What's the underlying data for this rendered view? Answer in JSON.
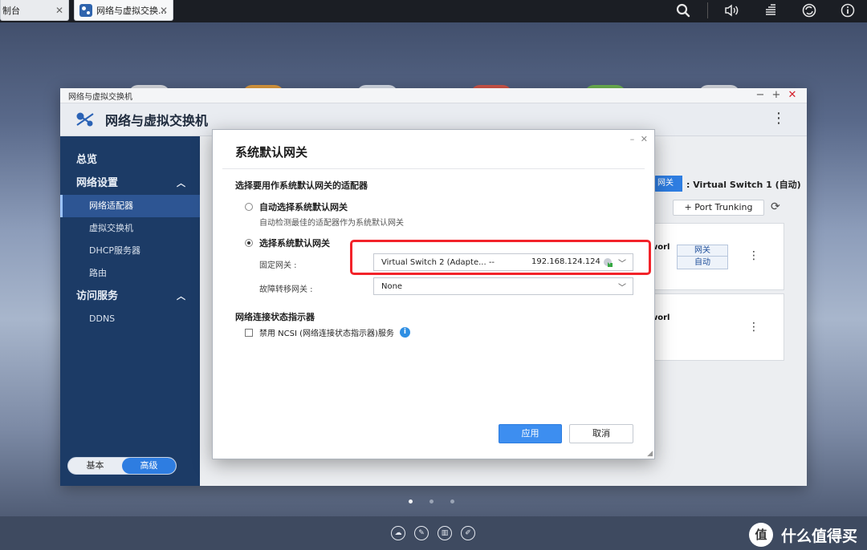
{
  "system_tabs": [
    {
      "label": "制台"
    },
    {
      "label": "网络与虚拟交换..."
    }
  ],
  "system_icons": [
    "search-icon",
    "volume-icon",
    "stack-icon",
    "sync-icon",
    "info-icon"
  ],
  "window": {
    "titlebar": "网络与虚拟交换机",
    "app_title": "网络与虚拟交换机",
    "controls": {
      "minimize": "−",
      "maximize": "+",
      "close": "✕"
    },
    "menu": "⋮"
  },
  "sidebar": {
    "overview": "总览",
    "network_settings": {
      "label": "网络设置",
      "items": [
        {
          "label": "网络适配器",
          "active": true
        },
        {
          "label": "虚拟交换机"
        },
        {
          "label": "DHCP服务器"
        },
        {
          "label": "路由"
        }
      ]
    },
    "access_services": {
      "label": "访问服务",
      "items": [
        {
          "label": "DDNS"
        }
      ]
    },
    "mode": {
      "basic": "基本",
      "advanced": "高级",
      "selected": "advanced"
    }
  },
  "content": {
    "vs_badge": "网关",
    "vs_label": ": Virtual Switch 1 (自动)",
    "port_trunking": "+ Port Trunking",
    "cards": [
      {
        "title": "worl",
        "gw_top": "网关",
        "gw_bottom": "自动"
      },
      {
        "title": "worl"
      }
    ]
  },
  "dialog": {
    "title": "系统默认网关",
    "controls": {
      "minimize": "–",
      "close": "✕"
    },
    "section_adapter": "选择要用作系统默认网关的适配器",
    "auto_option": {
      "label": "自动选择系统默认网关",
      "hint": "自动检测最佳的适配器作为系统默认网关",
      "selected": false
    },
    "manual_option": {
      "label": "选择系统默认网关",
      "selected": true
    },
    "fixed_gateway": {
      "label": "固定网关 :",
      "value_name": "Virtual Switch 2 (Adapte... --",
      "value_ip": "192.168.124.124"
    },
    "failover_gateway": {
      "label": "故障转移网关 :",
      "value": "None"
    },
    "section_ncsi": "网络连接状态指示器",
    "ncsi_checkbox": {
      "label": "禁用 NCSI (网络连接状态指示器)服务",
      "checked": false
    },
    "apply": "应用",
    "cancel": "取消"
  },
  "pager": {
    "total": 3,
    "current": 1
  },
  "watermark": {
    "logo": "值",
    "text": "什么值得买"
  },
  "colors": {
    "sidebar": "#1c3b66",
    "accent": "#2e7de1",
    "apply": "#3d8ef0",
    "highlight": "#f2232a"
  }
}
